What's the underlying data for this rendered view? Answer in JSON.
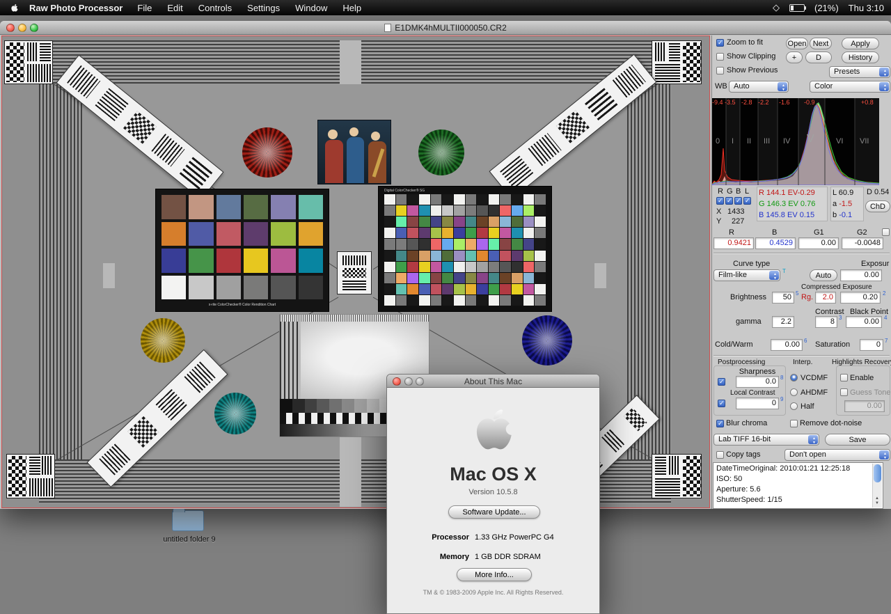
{
  "menubar": {
    "app": "Raw Photo Processor",
    "menus": [
      "File",
      "Edit",
      "Controls",
      "Settings",
      "Window",
      "Help"
    ],
    "battery": "(21%)",
    "clock": "Thu 3:10"
  },
  "window": {
    "title": "E1DMK4hMULTII000050.CR2"
  },
  "panel": {
    "row1": {
      "zoom": "Zoom to fit",
      "open": "Open",
      "next": "Next",
      "apply": "Apply"
    },
    "row2": {
      "clip": "Show Clipping",
      "plus": "+",
      "d": "D",
      "history": "History"
    },
    "row3": {
      "prev": "Show Previous",
      "presets": "Presets"
    },
    "row4": {
      "wb": "WB",
      "wb_value": "Auto",
      "color_value": "Color"
    },
    "histogram": {
      "ev": [
        "-9.4",
        "-3.5",
        "-2.8",
        "-2.2",
        "-1.6",
        "-0.9",
        "+0.8"
      ],
      "zones": [
        "0",
        "I",
        "II",
        "III",
        "IV",
        "V",
        "VI",
        "VII"
      ]
    },
    "probe": {
      "ch": [
        "R",
        "G",
        "B",
        "L"
      ],
      "x_label": "X",
      "x": "1433",
      "y_label": "Y",
      "y": "227",
      "r": "R 144.1 EV-0.29",
      "g": "G 146.3 EV 0.76",
      "b": "B 145.8 EV 0.15",
      "L_label": "L",
      "L": "60.9",
      "a_label": "a",
      "a": "-1.5",
      "b2_label": "b",
      "b2": "-0.1",
      "d": "D 0.54",
      "chd": "ChD"
    },
    "mult": {
      "headers": [
        "R",
        "B",
        "G1",
        "G2"
      ],
      "values": [
        "0.9421",
        "0.4529",
        "0.00",
        "-0.0048"
      ]
    },
    "curve": {
      "label": "Curve type",
      "exposure_label": "Exposur",
      "film": "Film-like",
      "t": "T",
      "auto": "Auto",
      "exposure": "0.00",
      "comp": "Compressed Exposure",
      "rg": "Rg.",
      "rg_val": "2.0",
      "comp_val": "0.20",
      "s2": "2",
      "brightness": "Brightness",
      "brightness_val": "50",
      "s5": "5",
      "contrast": "Contrast",
      "black_point": "Black Point",
      "contrast_val": "8",
      "s3": "3",
      "bp_val": "0.00",
      "s4": "4",
      "gamma": "gamma",
      "gamma_val": "2.2"
    },
    "tone": {
      "cold": "Cold/Warm",
      "cold_val": "0.00",
      "s6": "6",
      "sat": "Saturation",
      "sat_val": "0",
      "s7": "7"
    },
    "post": {
      "title": "Postprocessing",
      "interp": "Interp.",
      "highlights": "Highlights Recovery",
      "sharp": "Sharpness",
      "sharp_val": "0.0",
      "s8": "8",
      "local": "Local Contrast",
      "local_val": "0",
      "s9": "9",
      "vcdmf": "VCDMF",
      "ahdmf": "AHDMF",
      "half": "Half",
      "enable": "Enable",
      "guess": "Guess Tone",
      "guess_val": "0.00"
    },
    "bottom": {
      "blur": "Blur chroma",
      "dot": "Remove dot-noise",
      "format": "Lab TIFF 16-bit",
      "save": "Save",
      "copy": "Copy tags",
      "open_mode": "Don't open"
    },
    "info": {
      "lines": [
        "DateTimeOriginal: 2010:01:21 12:25:18",
        "ISO: 50",
        "Aperture: 5.6",
        "ShutterSpeed: 1/15"
      ]
    }
  },
  "about": {
    "title": "About This Mac",
    "os": "Mac OS X",
    "version": "Version 10.5.8",
    "update": "Software Update...",
    "cpu_label": "Processor",
    "cpu": "1.33 GHz PowerPC G4",
    "mem_label": "Memory",
    "mem": "1 GB DDR SDRAM",
    "more": "More Info...",
    "copyright": "TM & © 1983-2009 Apple Inc. All Rights Reserved."
  },
  "desktop": {
    "folder": "untitled folder 9"
  },
  "image": {
    "colorchecker": {
      "caption": "x-rite ColorChecker® Color Rendition Chart",
      "colors": [
        "#735244",
        "#c29682",
        "#627a9d",
        "#576c43",
        "#8580b1",
        "#67bdaa",
        "#d67e2c",
        "#505ba6",
        "#c15a63",
        "#5e3c6c",
        "#9dbc40",
        "#e0a32e",
        "#383d96",
        "#469449",
        "#af363c",
        "#e7c71f",
        "#bb5695",
        "#0885a1",
        "#f3f3f2",
        "#c8c8c8",
        "#a0a0a0",
        "#7a7a79",
        "#555555",
        "#343434"
      ]
    },
    "sg": {
      "caption": "Digital ColorChecker® SG",
      "border_cycle": [
        "#f2f2f0",
        "#7a7a7a",
        "#181818"
      ],
      "palette": [
        "#6b4226",
        "#d9a066",
        "#8ab6d6",
        "#4f6d3a",
        "#9a8fc2",
        "#63c1b0",
        "#e2882f",
        "#4a5fb4",
        "#c1525e",
        "#5d3a6e",
        "#a7c24a",
        "#e8b22e",
        "#3b3f9e",
        "#3f9e4a",
        "#b23a42",
        "#e8d020",
        "#c258a0",
        "#1f90b0",
        "#f0f0ee",
        "#c8c8c8",
        "#a2a2a2",
        "#7c7c7c",
        "#565656",
        "#303030",
        "#ee6666",
        "#66aaee",
        "#aaee66",
        "#eeaa66",
        "#aa66ee",
        "#66eeaa",
        "#884444",
        "#448844",
        "#444488",
        "#888844",
        "#884488",
        "#448888"
      ]
    },
    "gray_chart": {
      "steps": [
        "#101010",
        "#282828",
        "#404040",
        "#585858",
        "#707070",
        "#888888",
        "#a0a0a0",
        "#b8b8b8",
        "#d0d0d0",
        "#e4e4e4",
        "#f4f4f4",
        "#ffffff"
      ]
    }
  },
  "colors": {
    "accent_blue": "#3c67c8",
    "hist_label_red": "#ff5040",
    "probe_red": "#c11616",
    "probe_green": "#119911",
    "probe_blue": "#2233cc"
  }
}
